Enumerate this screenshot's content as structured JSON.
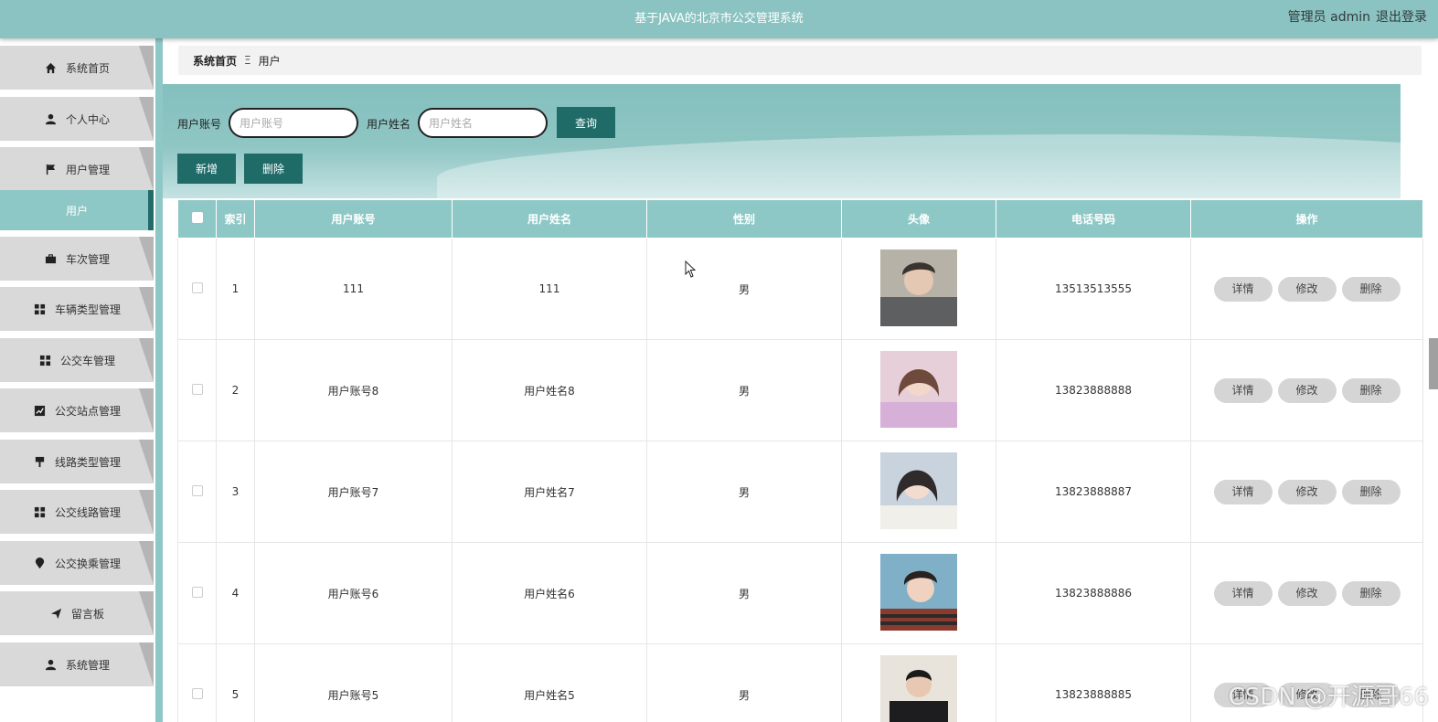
{
  "header": {
    "title": "基于JAVA的北京市公交管理系统",
    "user": "管理员 admin",
    "logout": "退出登录"
  },
  "sidebar": {
    "items": [
      {
        "label": "系统首页",
        "icon": "home-icon"
      },
      {
        "label": "个人中心",
        "icon": "user-icon"
      },
      {
        "label": "用户管理",
        "icon": "flag-icon"
      },
      {
        "label": "用户",
        "icon": ""
      },
      {
        "label": "车次管理",
        "icon": "briefcase-icon"
      },
      {
        "label": "车辆类型管理",
        "icon": "grid-icon"
      },
      {
        "label": "公交车管理",
        "icon": "grid-icon"
      },
      {
        "label": "公交站点管理",
        "icon": "chart-icon"
      },
      {
        "label": "线路类型管理",
        "icon": "pin-icon"
      },
      {
        "label": "公交线路管理",
        "icon": "grid-icon"
      },
      {
        "label": "公交换乘管理",
        "icon": "map-marker-icon"
      },
      {
        "label": "留言板",
        "icon": "send-icon"
      },
      {
        "label": "系统管理",
        "icon": "user-icon"
      }
    ]
  },
  "breadcrumb": {
    "home": "系统首页",
    "separator": "Ξ",
    "current": "用户"
  },
  "search": {
    "account_label": "用户账号",
    "account_placeholder": "用户账号",
    "name_label": "用户姓名",
    "name_placeholder": "用户姓名",
    "query_button": "查询",
    "add_button": "新增",
    "delete_button": "删除"
  },
  "table": {
    "headers": [
      "索引",
      "用户账号",
      "用户姓名",
      "性别",
      "头像",
      "电话号码",
      "操作"
    ],
    "rows": [
      {
        "index": "1",
        "account": "111",
        "name": "111",
        "gender": "男",
        "phone": "13513513555"
      },
      {
        "index": "2",
        "account": "用户账号8",
        "name": "用户姓名8",
        "gender": "男",
        "phone": "13823888888"
      },
      {
        "index": "3",
        "account": "用户账号7",
        "name": "用户姓名7",
        "gender": "男",
        "phone": "13823888887"
      },
      {
        "index": "4",
        "account": "用户账号6",
        "name": "用户姓名6",
        "gender": "男",
        "phone": "13823888886"
      },
      {
        "index": "5",
        "account": "用户账号5",
        "name": "用户姓名5",
        "gender": "男",
        "phone": "13823888885"
      }
    ],
    "actions": {
      "detail": "详情",
      "edit": "修改",
      "delete": "删除"
    }
  },
  "watermark": "CSDN @开源哥66",
  "colors": {
    "primary": "#8ec8c6",
    "dark": "#1f6b68",
    "topbar": "#8bc3c2"
  }
}
